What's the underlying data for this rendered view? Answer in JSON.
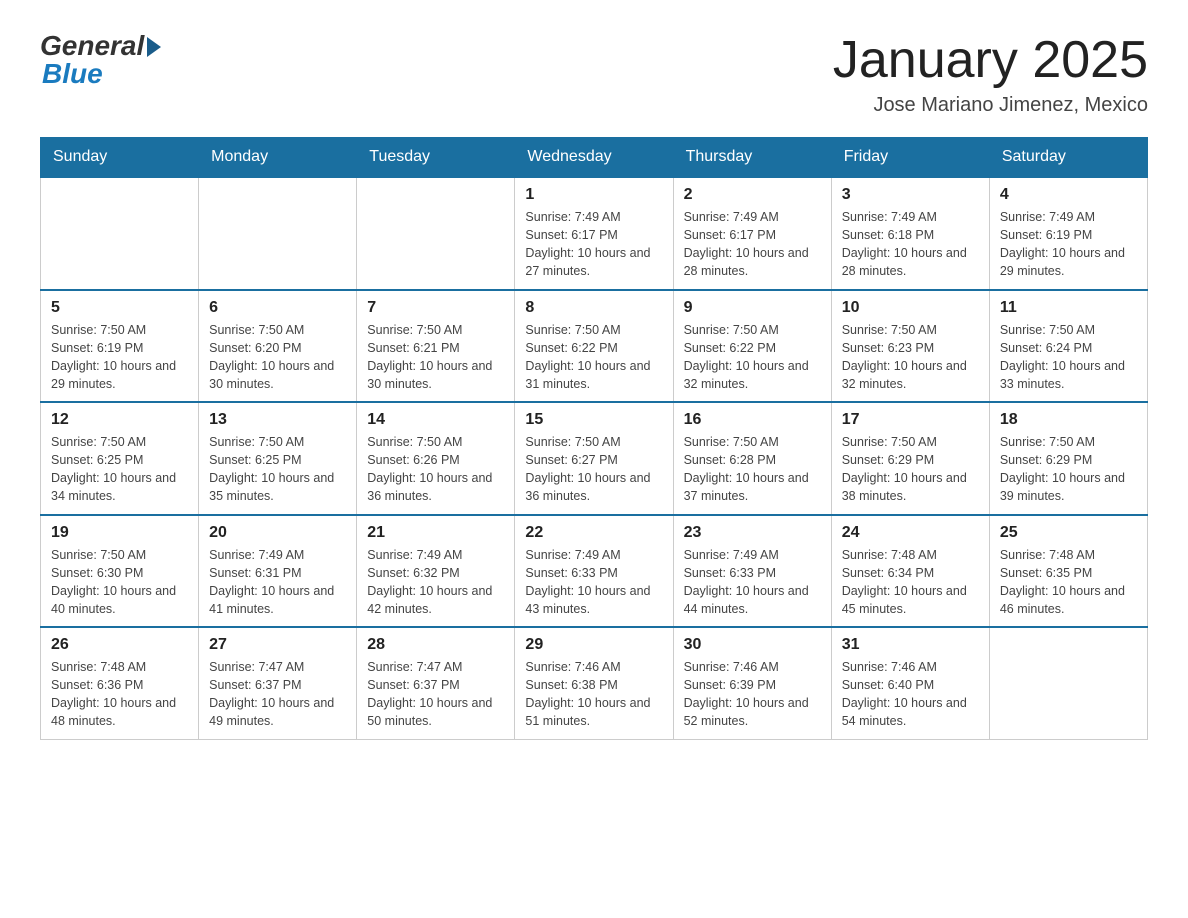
{
  "logo": {
    "general": "General",
    "blue": "Blue"
  },
  "title": "January 2025",
  "location": "Jose Mariano Jimenez, Mexico",
  "days_of_week": [
    "Sunday",
    "Monday",
    "Tuesday",
    "Wednesday",
    "Thursday",
    "Friday",
    "Saturday"
  ],
  "weeks": [
    [
      {
        "day": "",
        "info": ""
      },
      {
        "day": "",
        "info": ""
      },
      {
        "day": "",
        "info": ""
      },
      {
        "day": "1",
        "info": "Sunrise: 7:49 AM\nSunset: 6:17 PM\nDaylight: 10 hours and 27 minutes."
      },
      {
        "day": "2",
        "info": "Sunrise: 7:49 AM\nSunset: 6:17 PM\nDaylight: 10 hours and 28 minutes."
      },
      {
        "day": "3",
        "info": "Sunrise: 7:49 AM\nSunset: 6:18 PM\nDaylight: 10 hours and 28 minutes."
      },
      {
        "day": "4",
        "info": "Sunrise: 7:49 AM\nSunset: 6:19 PM\nDaylight: 10 hours and 29 minutes."
      }
    ],
    [
      {
        "day": "5",
        "info": "Sunrise: 7:50 AM\nSunset: 6:19 PM\nDaylight: 10 hours and 29 minutes."
      },
      {
        "day": "6",
        "info": "Sunrise: 7:50 AM\nSunset: 6:20 PM\nDaylight: 10 hours and 30 minutes."
      },
      {
        "day": "7",
        "info": "Sunrise: 7:50 AM\nSunset: 6:21 PM\nDaylight: 10 hours and 30 minutes."
      },
      {
        "day": "8",
        "info": "Sunrise: 7:50 AM\nSunset: 6:22 PM\nDaylight: 10 hours and 31 minutes."
      },
      {
        "day": "9",
        "info": "Sunrise: 7:50 AM\nSunset: 6:22 PM\nDaylight: 10 hours and 32 minutes."
      },
      {
        "day": "10",
        "info": "Sunrise: 7:50 AM\nSunset: 6:23 PM\nDaylight: 10 hours and 32 minutes."
      },
      {
        "day": "11",
        "info": "Sunrise: 7:50 AM\nSunset: 6:24 PM\nDaylight: 10 hours and 33 minutes."
      }
    ],
    [
      {
        "day": "12",
        "info": "Sunrise: 7:50 AM\nSunset: 6:25 PM\nDaylight: 10 hours and 34 minutes."
      },
      {
        "day": "13",
        "info": "Sunrise: 7:50 AM\nSunset: 6:25 PM\nDaylight: 10 hours and 35 minutes."
      },
      {
        "day": "14",
        "info": "Sunrise: 7:50 AM\nSunset: 6:26 PM\nDaylight: 10 hours and 36 minutes."
      },
      {
        "day": "15",
        "info": "Sunrise: 7:50 AM\nSunset: 6:27 PM\nDaylight: 10 hours and 36 minutes."
      },
      {
        "day": "16",
        "info": "Sunrise: 7:50 AM\nSunset: 6:28 PM\nDaylight: 10 hours and 37 minutes."
      },
      {
        "day": "17",
        "info": "Sunrise: 7:50 AM\nSunset: 6:29 PM\nDaylight: 10 hours and 38 minutes."
      },
      {
        "day": "18",
        "info": "Sunrise: 7:50 AM\nSunset: 6:29 PM\nDaylight: 10 hours and 39 minutes."
      }
    ],
    [
      {
        "day": "19",
        "info": "Sunrise: 7:50 AM\nSunset: 6:30 PM\nDaylight: 10 hours and 40 minutes."
      },
      {
        "day": "20",
        "info": "Sunrise: 7:49 AM\nSunset: 6:31 PM\nDaylight: 10 hours and 41 minutes."
      },
      {
        "day": "21",
        "info": "Sunrise: 7:49 AM\nSunset: 6:32 PM\nDaylight: 10 hours and 42 minutes."
      },
      {
        "day": "22",
        "info": "Sunrise: 7:49 AM\nSunset: 6:33 PM\nDaylight: 10 hours and 43 minutes."
      },
      {
        "day": "23",
        "info": "Sunrise: 7:49 AM\nSunset: 6:33 PM\nDaylight: 10 hours and 44 minutes."
      },
      {
        "day": "24",
        "info": "Sunrise: 7:48 AM\nSunset: 6:34 PM\nDaylight: 10 hours and 45 minutes."
      },
      {
        "day": "25",
        "info": "Sunrise: 7:48 AM\nSunset: 6:35 PM\nDaylight: 10 hours and 46 minutes."
      }
    ],
    [
      {
        "day": "26",
        "info": "Sunrise: 7:48 AM\nSunset: 6:36 PM\nDaylight: 10 hours and 48 minutes."
      },
      {
        "day": "27",
        "info": "Sunrise: 7:47 AM\nSunset: 6:37 PM\nDaylight: 10 hours and 49 minutes."
      },
      {
        "day": "28",
        "info": "Sunrise: 7:47 AM\nSunset: 6:37 PM\nDaylight: 10 hours and 50 minutes."
      },
      {
        "day": "29",
        "info": "Sunrise: 7:46 AM\nSunset: 6:38 PM\nDaylight: 10 hours and 51 minutes."
      },
      {
        "day": "30",
        "info": "Sunrise: 7:46 AM\nSunset: 6:39 PM\nDaylight: 10 hours and 52 minutes."
      },
      {
        "day": "31",
        "info": "Sunrise: 7:46 AM\nSunset: 6:40 PM\nDaylight: 10 hours and 54 minutes."
      },
      {
        "day": "",
        "info": ""
      }
    ]
  ]
}
